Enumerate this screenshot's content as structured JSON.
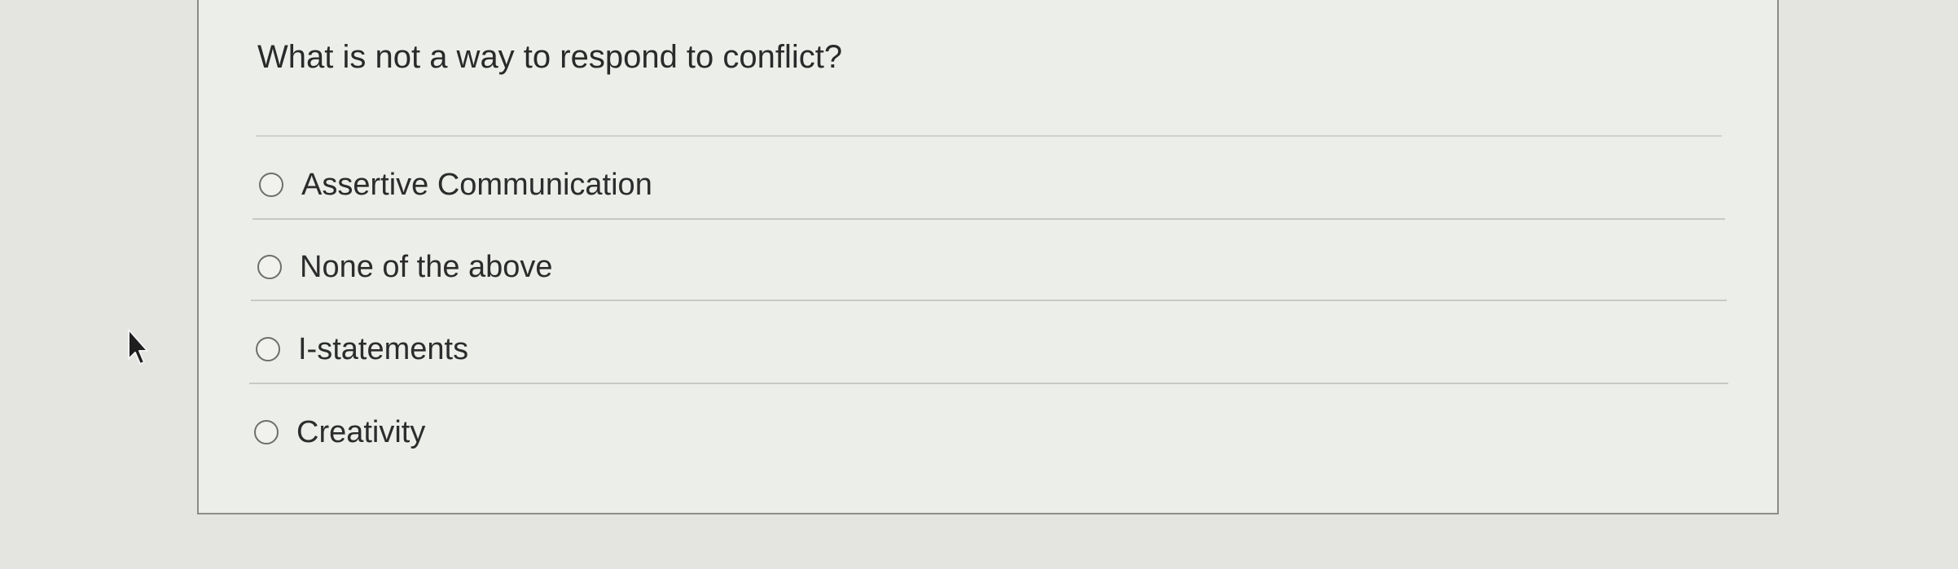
{
  "quiz": {
    "question": "What is not a way to respond to conflict?",
    "options": [
      {
        "label": "Assertive Communication",
        "selected": false
      },
      {
        "label": "None of the above",
        "selected": false
      },
      {
        "label": "I-statements",
        "selected": false
      },
      {
        "label": "Creativity",
        "selected": false
      }
    ]
  },
  "icons": {
    "cursor": "mouse-pointer-icon",
    "radio": "radio-button-icon"
  }
}
